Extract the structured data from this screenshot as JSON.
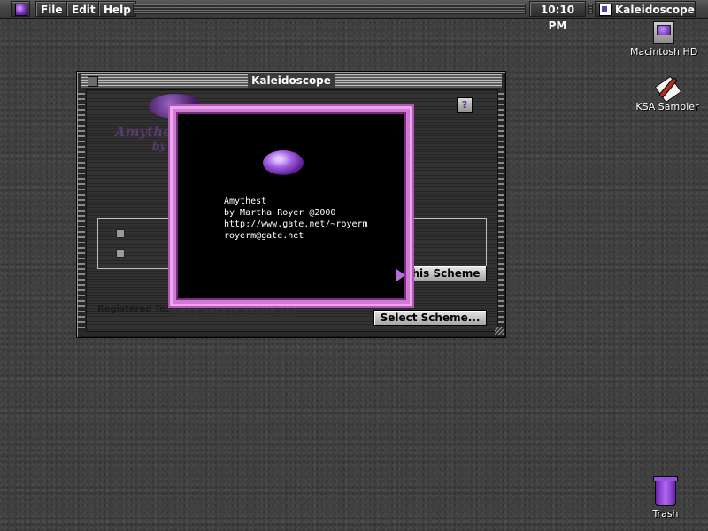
{
  "menubar": {
    "apple_icon": "apple-menu-gem-icon",
    "file": "File",
    "edit": "Edit",
    "help": "Help",
    "clock": "10:10 PM",
    "app_name": "Kaleidoscope"
  },
  "desktop": {
    "icons": [
      {
        "label": "Macintosh HD",
        "icon": "hard-disk-icon"
      },
      {
        "label": "KSA Sampler",
        "icon": "document-pen-icon"
      },
      {
        "label": "Trash",
        "icon": "trash-icon"
      }
    ]
  },
  "window": {
    "title": "Kaleidoscope",
    "help_label": "?",
    "banner_line1": "Amythest",
    "banner_line2": "by M",
    "this_scheme_button": "his Scheme",
    "select_scheme_button": "Select Scheme...",
    "registered_label": "Registered To:",
    "registered_line1": "A840-11934S-VWWE-388",
    "registered_line2": "A840-11934S-VWWE-388"
  },
  "about": {
    "name": "Amythest",
    "author": "by Martha Royer @2000",
    "url": "http://www.gate.net/~royerm",
    "email": "royerm@gate.net"
  },
  "colors": {
    "desktop": "#3f3f3f",
    "accent_purple": "#b653bb",
    "gem_purple": "#7a2fc4"
  }
}
